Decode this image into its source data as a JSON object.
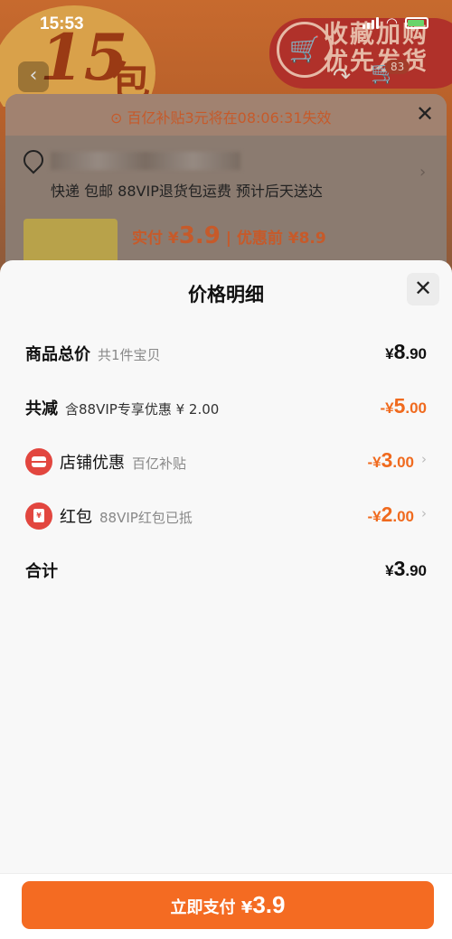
{
  "status_bar": {
    "time": "15:53"
  },
  "background_page": {
    "banner_number": "15",
    "banner_unit": "包",
    "promo_text": "收藏加购\n优先发货",
    "cart_badge": "83",
    "notice": "百亿补贴3元将在08:06:31失效",
    "shipping": "快递 包邮 88VIP退货包运费 预计后天送达",
    "price_line": {
      "prefix": "实付 ¥",
      "amount": "3.9",
      "suffix": "| 优惠前 ¥8.9"
    }
  },
  "sheet": {
    "title": "价格明细",
    "rows": {
      "total": {
        "label": "商品总价",
        "sub": "共1件宝贝",
        "currency": "¥",
        "integer": "8",
        "decimal": ".90"
      },
      "discount": {
        "label": "共减",
        "sub": "含88VIP专享优惠 ¥ 2.00",
        "prefix": "-¥",
        "integer": "5",
        "decimal": ".00"
      },
      "store": {
        "label": "店铺优惠",
        "sub": "百亿补贴",
        "prefix": "-¥",
        "integer": "3",
        "decimal": ".00"
      },
      "hongbao": {
        "label": "红包",
        "sub": "88VIP红包已抵",
        "prefix": "-¥",
        "integer": "2",
        "decimal": ".00"
      },
      "sum": {
        "label": "合计",
        "currency": "¥",
        "integer": "3",
        "decimal": ".90"
      }
    },
    "pay_button": {
      "label": "立即支付 ¥",
      "amount": "3.9"
    }
  },
  "colors": {
    "accent": "#f46b22",
    "discount": "#f06a1e",
    "icon_red": "#e2463f"
  }
}
